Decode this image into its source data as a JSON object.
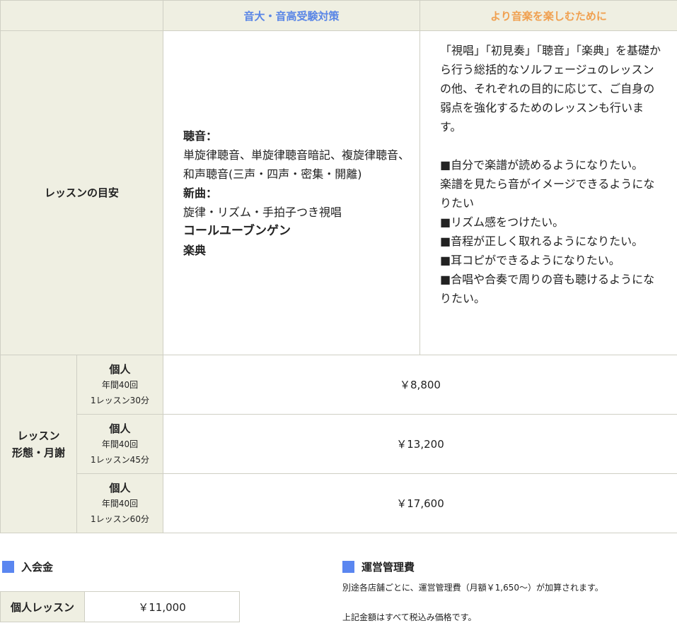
{
  "header": {
    "col_exam": "音大・音高受験対策",
    "col_enjoy": "より音楽を楽しむために"
  },
  "goal": {
    "label": "レッスンの目安",
    "exam": {
      "listening_title": "聴音：",
      "listening_body": "単旋律聴音、単旋律聴音暗記、複旋律聴音、和声聴音(三声・四声・密集・開離)",
      "newsong_title": "新曲：",
      "newsong_body": "旋律・リズム・手拍子つき視唱",
      "koruyubungen": "コールユーブンゲン",
      "gakuten": "楽典"
    },
    "enjoy": {
      "intro": "「視唱」「初見奏」「聴音」「楽典」を基礎から行う総括的なソルフェージュのレッスンの他、それぞれの目的に応じて、ご自身の弱点を強化するためのレッスンも行います。",
      "items": [
        "■自分で楽譜が読めるようになりたい。",
        "楽譜を見たら音がイメージできるようになりたい",
        "■リズム感をつけたい。",
        "■音程が正しく取れるようになりたい。",
        "■耳コピができるようになりたい。",
        "■合唱や合奏で周りの音も聴けるようになりたい。"
      ]
    }
  },
  "fees": {
    "label_line1": "レッスン",
    "label_line2": "形態・月謝",
    "rows": [
      {
        "type": "個人",
        "count": "年間40回",
        "length": "1レッスン30分",
        "price": "￥8,800"
      },
      {
        "type": "個人",
        "count": "年間40回",
        "length": "1レッスン45分",
        "price": "￥13,200"
      },
      {
        "type": "個人",
        "count": "年間40回",
        "length": "1レッスン60分",
        "price": "￥17,600"
      }
    ]
  },
  "admission": {
    "title": "入会金",
    "label": "個人レッスン",
    "price": "￥11,000"
  },
  "management": {
    "title": "運営管理費",
    "note": "別途各店舗ごとに、運営管理費（月額￥1,650～）が加算されます。",
    "tax_note": "上記金額はすべて税込み価格です。"
  },
  "colors": {
    "accent_blue": "#5a86e6",
    "accent_orange": "#f0a050",
    "label_bg": "#efefe2"
  }
}
